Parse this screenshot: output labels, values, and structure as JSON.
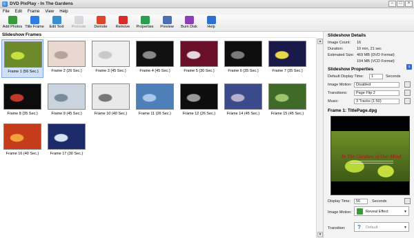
{
  "window": {
    "title": "DVD PixPlay - In The Gardens"
  },
  "menu": [
    "File",
    "Edit",
    "Frame",
    "View",
    "Help"
  ],
  "toolbar": [
    {
      "label": "Add Photos",
      "icon": "add-photos-icon",
      "color": "#3a9a3a",
      "disabled": false
    },
    {
      "label": "Title Frame",
      "icon": "title-frame-icon",
      "color": "#2f7de0",
      "disabled": false
    },
    {
      "label": "Edit Text",
      "icon": "edit-text-icon",
      "color": "#3a8fcf",
      "disabled": false
    },
    {
      "label": "Promote",
      "icon": "promote-icon",
      "color": "#9aa4b3",
      "disabled": true
    },
    {
      "label": "Demote",
      "icon": "demote-icon",
      "color": "#d9462c",
      "disabled": false
    },
    {
      "label": "Remove",
      "icon": "remove-icon",
      "color": "#d72c2c",
      "disabled": false
    },
    {
      "label": "Properties",
      "icon": "properties-icon",
      "color": "#2a9d4f",
      "disabled": false
    },
    {
      "label": "Preview",
      "icon": "preview-icon",
      "color": "#4b6fb0",
      "disabled": false
    },
    {
      "label": "Burn Disk",
      "icon": "burn-disk-icon",
      "color": "#8a3fb6",
      "disabled": false
    },
    {
      "label": "Help",
      "icon": "help-icon",
      "color": "#2f6fd0",
      "disabled": false
    }
  ],
  "frames_panel": {
    "title": "Slideshow Frames",
    "frames": [
      {
        "caption": "Frame 1  (56 Sec.)",
        "bg": "#6c8a2a",
        "accent": "#c8e040",
        "selected": true
      },
      {
        "caption": "Frame 2  (26 Sec.)",
        "bg": "#e8d8d0",
        "accent": "#b6a39a",
        "selected": false
      },
      {
        "caption": "Frame 3  (45 Sec.)",
        "bg": "#efefef",
        "accent": "#c9c9c9",
        "selected": false
      },
      {
        "caption": "Frame 4  (45 Sec.)",
        "bg": "#111111",
        "accent": "#888888",
        "selected": false
      },
      {
        "caption": "Frame 5  (30 Sec.)",
        "bg": "#6a0f2a",
        "accent": "#e6d5dc",
        "selected": false
      },
      {
        "caption": "Frame 6  (35 Sec.)",
        "bg": "#0e0e0e",
        "accent": "#7a7a7a",
        "selected": false
      },
      {
        "caption": "Frame 7  (35 Sec.)",
        "bg": "#1a1a4a",
        "accent": "#e8d84a",
        "selected": false
      },
      {
        "caption": "Frame 8  (35 Sec.)",
        "bg": "#0c0c0c",
        "accent": "#c0392b",
        "selected": false
      },
      {
        "caption": "Frame 9  (45 Sec.)",
        "bg": "#c9d4df",
        "accent": "#7a8c9c",
        "selected": false
      },
      {
        "caption": "Frame 10  (40 Sec.)",
        "bg": "#e9e9e9",
        "accent": "#777777",
        "selected": false
      },
      {
        "caption": "Frame 11  (26 Sec.)",
        "bg": "#4f7fb8",
        "accent": "#a9c7ec",
        "selected": false
      },
      {
        "caption": "Frame 12  (26 Sec.)",
        "bg": "#0d0d0d",
        "accent": "#9a9a9a",
        "selected": false
      },
      {
        "caption": "Frame 14  (45 Sec.)",
        "bg": "#3a4a8a",
        "accent": "#b7b0d0",
        "selected": false
      },
      {
        "caption": "Frame 15  (45 Sec.)",
        "bg": "#3f6a2a",
        "accent": "#9fc46b",
        "selected": false
      },
      {
        "caption": "Frame 16  (40 Sec.)",
        "bg": "#c43c1a",
        "accent": "#f6a23a",
        "selected": false
      },
      {
        "caption": "Frame 17  (30 Sec.)",
        "bg": "#1c2a6a",
        "accent": "#d8e3f2",
        "selected": false
      }
    ]
  },
  "details": {
    "title": "Slideshow Details",
    "image_count_label": "Image Count:",
    "image_count": "16",
    "duration_label": "Duration:",
    "duration": "10 min, 21 sec",
    "est_size_label": "Estimated Size:",
    "est_size_dvd": "469 MB (DVD Format)",
    "est_size_vcd": "104 MB (VCD Format)"
  },
  "properties": {
    "title": "Slideshow Properties",
    "default_display_label": "Default Display Time:",
    "default_display_value": "1",
    "seconds_label": "Seconds",
    "image_motion_label": "Image Motion:",
    "image_motion_value": "Disabled",
    "transitions_label": "Transitions:",
    "transitions_value": "Page Flip 2",
    "music_label": "Music:",
    "music_value": "3 Tracks (1:50)"
  },
  "frame_info": {
    "title": "Frame 1: TitlePage.dpg",
    "preview_title": "In The Gardens of Our Mind",
    "display_time_label": "Display Time:",
    "display_time_value": "56",
    "seconds_label": "Seconds",
    "image_motion_label": "Image Motion:",
    "image_motion_value": "Reveal Effect",
    "transition_label": "Transition:",
    "transition_value": "Default"
  }
}
